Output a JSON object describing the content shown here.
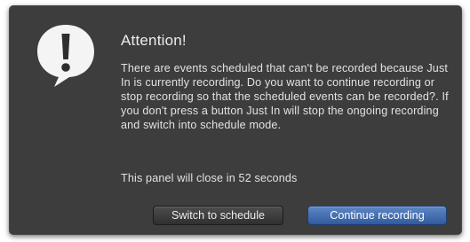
{
  "dialog": {
    "icon": "exclamation-speech-bubble-icon",
    "title": "Attention!",
    "message": "There are events scheduled that can't be recorded because Just In is currently recording. Do you want to continue recording or stop recording so that the scheduled events can be recorded?. If you don't press a button Just In will stop the ongoing recording and switch into schedule mode.",
    "countdown": "This panel will close in 52 seconds"
  },
  "buttons": {
    "switch_to_schedule": "Switch to schedule",
    "continue_recording": "Continue recording"
  },
  "colors": {
    "panel_background": "#3d3d3d",
    "text": "#e2e2e2",
    "primary_button": "#3f6db0"
  }
}
